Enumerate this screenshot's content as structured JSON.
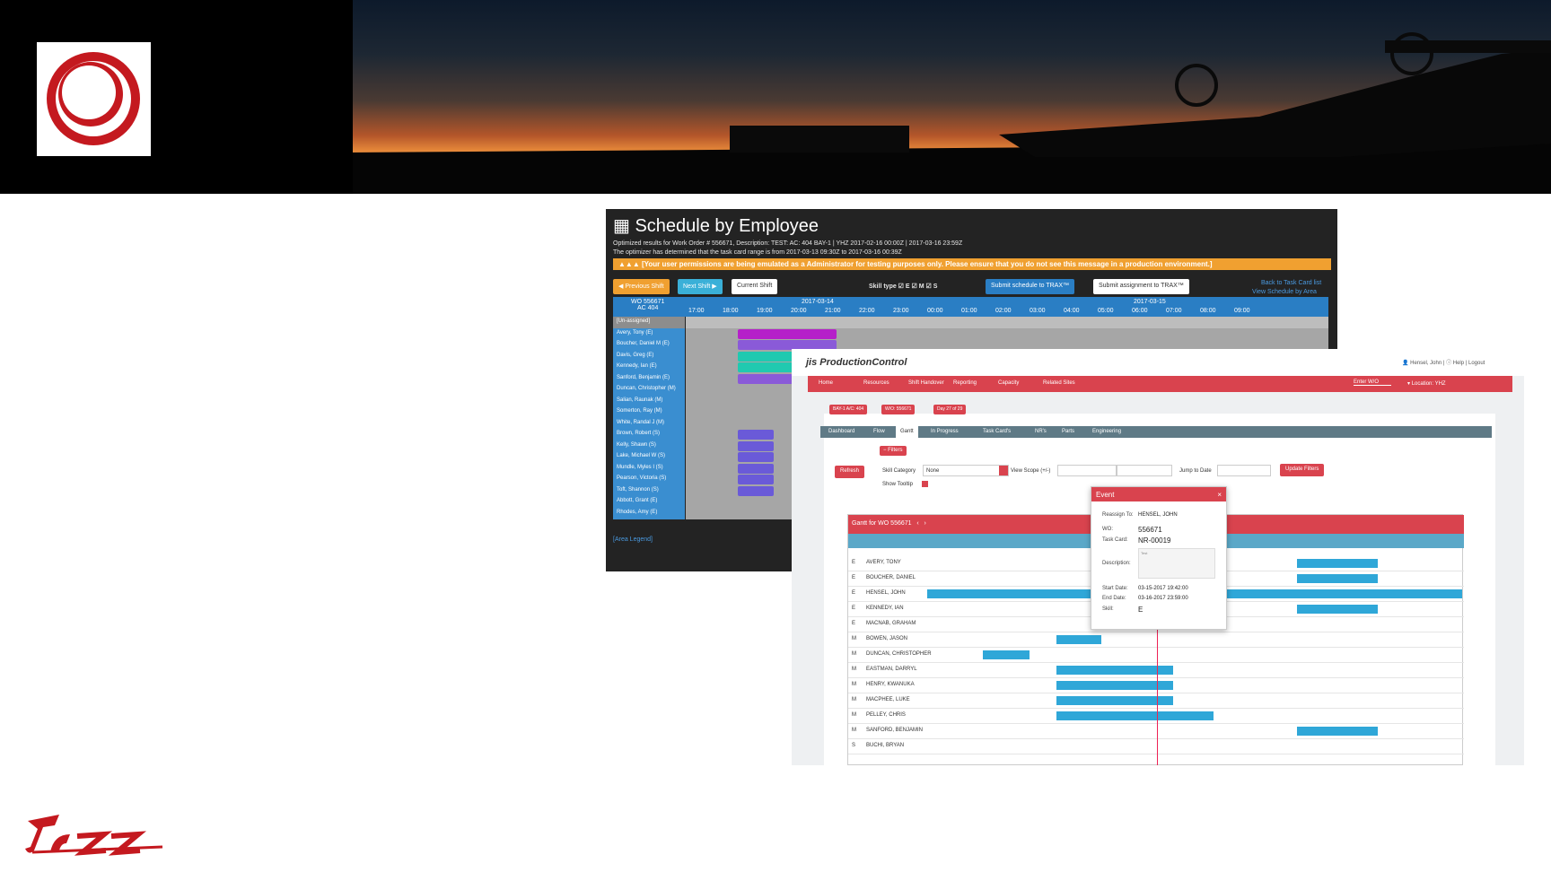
{
  "sbe": {
    "title": "Schedule by Employee",
    "line1": "Optimized results for Work Order # 556671, Description: TEST: AC: 404 BAY-1 | YHZ 2017-02-16 00:00Z | 2017-03-16 23:59Z",
    "line2": "The optimizer has determined that the task card range is from 2017-03-13 09:30Z to 2017-03-16 00:39Z",
    "warning": "[Your user permissions are being emulated as a Administrator for testing purposes only. Please ensure that you do not see this message in a production environment.]",
    "buttons": {
      "prev": "◀ Previous Shift",
      "next": "Next Shift ▶",
      "current": "Current Shift",
      "submit_schedule": "Submit schedule to TRAX™",
      "submit_assignment": "Submit assignment to TRAX™"
    },
    "skill_type": "Skill type  ☑ E  ☑ M  ☑ S",
    "links": [
      "Back to Task Card list",
      "View Schedule by Area"
    ],
    "wo_label": "WO 556671\nAC 404",
    "dates": [
      "2017-03-14",
      "2017-03-15"
    ],
    "times": [
      "17:00",
      "18:00",
      "19:00",
      "20:00",
      "21:00",
      "22:00",
      "23:00",
      "00:00",
      "01:00",
      "02:00",
      "03:00",
      "04:00",
      "05:00",
      "06:00",
      "07:00",
      "08:00",
      "09:00"
    ],
    "employees": [
      "[Un-assigned]",
      "Avery, Tony (E)",
      "Boucher, Daniel M (E)",
      "Davis, Greg (E)",
      "Kennedy, Ian (E)",
      "Sanford, Benjamin (E)",
      "Duncan, Christopher (M)",
      "Salian, Raunak (M)",
      "Somerton, Ray (M)",
      "White, Randal J (M)",
      "Brown, Robert (S)",
      "Kelly, Shawn (S)",
      "Lake, Michael W (S)",
      "Mundle, Myles I (S)",
      "Pearson, Victoria (S)",
      "Toft, Shannon (S)",
      "Abbott, Grant (E)",
      "Rhodes, Amy (E)"
    ],
    "legend": "[Area Legend]"
  },
  "pc": {
    "brand": "ProductionControl",
    "user": "Hensel, John",
    "help": "Help",
    "logout": "Logout",
    "nav": [
      "Home",
      "Resources",
      "Shift Handover",
      "Reporting",
      "Capacity",
      "Related Sites"
    ],
    "enter_wo": "Enter W/O",
    "location": "Location: YHZ",
    "crumbs": [
      "BAY-1 A/C: 404",
      "W/O: 556671",
      "Day 27 of 29"
    ],
    "tabs": [
      "Dashboard",
      "Flow",
      "Gantt",
      "In Progress",
      "Task Card's",
      "NR's",
      "Parts",
      "Engineering"
    ],
    "filters": "Filters",
    "refresh": "Refresh",
    "skill_category": "Skill Category",
    "skill_value": "None",
    "view_scope": "View Scope (+/-)",
    "jump": "Jump to Date",
    "update": "Update Filters",
    "show_tooltip": "Show Tooltip",
    "gantt_title": "Gantt for WO 556671",
    "resources": [
      {
        "skill": "E",
        "name": "AVERY, TONY"
      },
      {
        "skill": "E",
        "name": "BOUCHER, DANIEL"
      },
      {
        "skill": "E",
        "name": "HENSEL, JOHN"
      },
      {
        "skill": "E",
        "name": "KENNEDY, IAN"
      },
      {
        "skill": "E",
        "name": "MACNAB, GRAHAM"
      },
      {
        "skill": "M",
        "name": "BOWEN, JASON"
      },
      {
        "skill": "M",
        "name": "DUNCAN, CHRISTOPHER"
      },
      {
        "skill": "M",
        "name": "EASTMAN, DARRYL"
      },
      {
        "skill": "M",
        "name": "HENRY, KWANUKA"
      },
      {
        "skill": "M",
        "name": "MACPHEE, LUKE"
      },
      {
        "skill": "M",
        "name": "PELLEY, CHRIS"
      },
      {
        "skill": "M",
        "name": "SANFORD, BENJAMIN"
      },
      {
        "skill": "S",
        "name": "BUCHI, BRYAN"
      }
    ],
    "event": {
      "title": "Event",
      "reassign_label": "Reassign To:",
      "reassign_value": "HENSEL, JOHN",
      "wo_label": "WO:",
      "wo_value": "556671",
      "tc_label": "Task Card:",
      "tc_value": "NR-00019",
      "desc_label": "Description:",
      "desc_value": "Test",
      "start_label": "Start Date:",
      "start_value": "03-15-2017 19:42:00",
      "end_label": "End Date:",
      "end_value": "03-16-2017 23:59:00",
      "skill_label": "Skill:",
      "skill_value": "E"
    }
  }
}
